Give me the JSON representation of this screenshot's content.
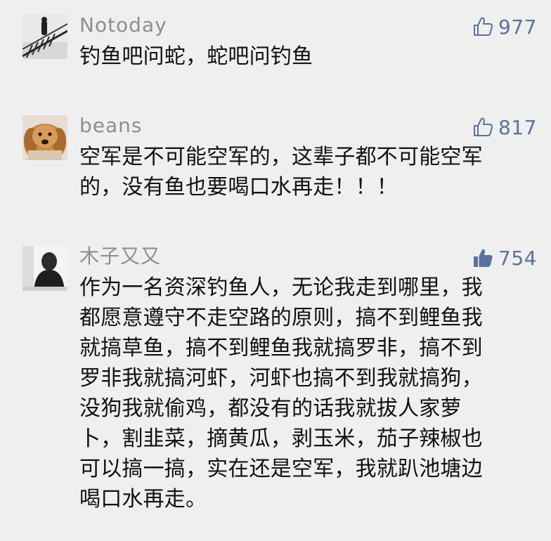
{
  "comments": [
    {
      "username": "Notoday",
      "likes": "977",
      "liked": false,
      "avatar": "avatar-icon",
      "lines": [
        "钓鱼吧问蛇，蛇吧问钓鱼"
      ]
    },
    {
      "username": "beans",
      "likes": "817",
      "liked": false,
      "avatar": "avatar-icon",
      "lines": [
        "空军是不可能空军的，这辈子都不可能空军",
        "的，没有鱼也要喝口水再走！！！"
      ]
    },
    {
      "username": "木子又又",
      "likes": "754",
      "liked": true,
      "avatar": "avatar-icon",
      "lines": [
        "作为一名资深钓鱼人，无论我走到哪里，我",
        "都愿意遵守不走空路的原则，搞不到鲤鱼我",
        "就搞草鱼，搞不到鲤鱼我就搞罗非，搞不到",
        "罗非我就搞河虾，河虾也搞不到我就搞狗，",
        "没狗我就偷鸡，都没有的话我就拔人家萝",
        "卜，割韭菜，摘黄瓜，剥玉米，茄子辣椒也",
        "可以搞一搞，实在还是空军，我就趴池塘边",
        "喝口水再走。"
      ]
    }
  ],
  "colors": {
    "background": "#efefef",
    "username": "#8e8e8e",
    "like_accent": "#5b7398",
    "text": "#111111"
  },
  "icons": {
    "like_outline": "thumbs-up-outline-icon",
    "like_filled": "thumbs-up-filled-icon"
  }
}
